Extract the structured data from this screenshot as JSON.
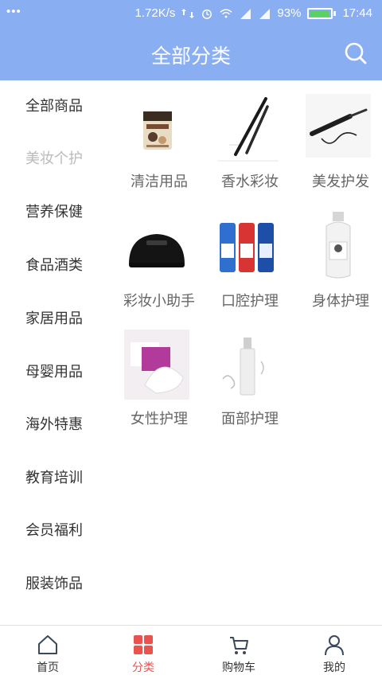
{
  "status_bar": {
    "net_speed": "1.72K/s",
    "battery_percent": "93%",
    "time": "17:44",
    "dots": "•••"
  },
  "header": {
    "title": "全部分类"
  },
  "sidebar": {
    "items": [
      {
        "label": "全部商品"
      },
      {
        "label": "美妆个护"
      },
      {
        "label": "营养保健"
      },
      {
        "label": "食品酒类"
      },
      {
        "label": "家居用品"
      },
      {
        "label": "母婴用品"
      },
      {
        "label": "海外特惠"
      },
      {
        "label": "教育培训"
      },
      {
        "label": "会员福利"
      },
      {
        "label": "服装饰品"
      }
    ],
    "active_index": 1
  },
  "categories": [
    {
      "label": "清洁用品",
      "icon": "cleaning-product-image"
    },
    {
      "label": "香水彩妆",
      "icon": "makeup-pencil-image"
    },
    {
      "label": "美发护发",
      "icon": "hair-curler-image"
    },
    {
      "label": "彩妆小助手",
      "icon": "nail-lamp-image"
    },
    {
      "label": "口腔护理",
      "icon": "toothpaste-image"
    },
    {
      "label": "身体护理",
      "icon": "body-lotion-image"
    },
    {
      "label": "女性护理",
      "icon": "feminine-care-image"
    },
    {
      "label": "面部护理",
      "icon": "facial-serum-image"
    }
  ],
  "tabbar": {
    "tabs": [
      {
        "label": "首页",
        "icon": "home-icon"
      },
      {
        "label": "分类",
        "icon": "grid-icon"
      },
      {
        "label": "购物车",
        "icon": "cart-icon"
      },
      {
        "label": "我的",
        "icon": "user-icon"
      }
    ],
    "active_index": 1
  },
  "colors": {
    "header_bg": "#8aaef2",
    "active_tab": "#e8534f",
    "active_sidebar_text": "#bbbbbb"
  }
}
